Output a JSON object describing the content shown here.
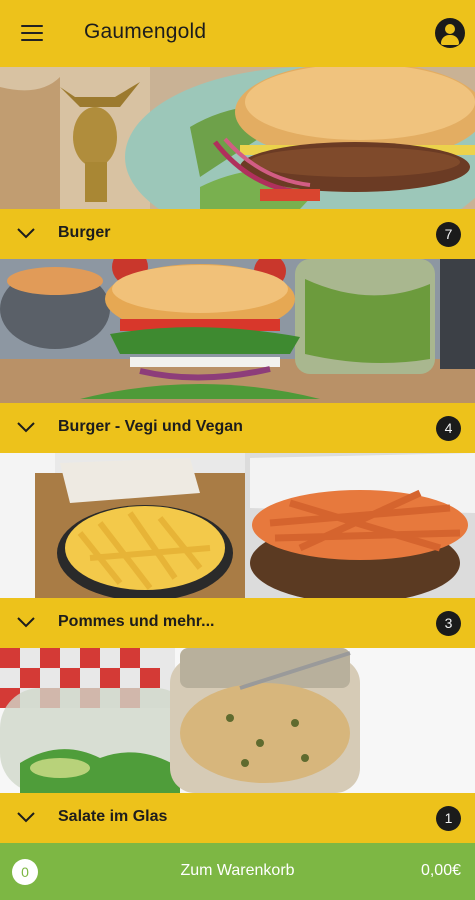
{
  "app": {
    "title": "Gaumengold"
  },
  "categories": [
    {
      "label": "Burger",
      "count": "7"
    },
    {
      "label": "Burger - Vegi und Vegan",
      "count": "4"
    },
    {
      "label": "Pommes und mehr...",
      "count": "3"
    },
    {
      "label": "Salate im Glas",
      "count": "1"
    }
  ],
  "cart": {
    "count": "0",
    "label": "Zum Warenkorb",
    "total": "0,00€"
  },
  "colors": {
    "accent": "#edc21b",
    "cart": "#7db744",
    "badge": "#1b1b1b"
  },
  "icons": {
    "menu": "hamburger-menu-icon",
    "account": "account-icon",
    "expand": "chevron-down-icon"
  }
}
